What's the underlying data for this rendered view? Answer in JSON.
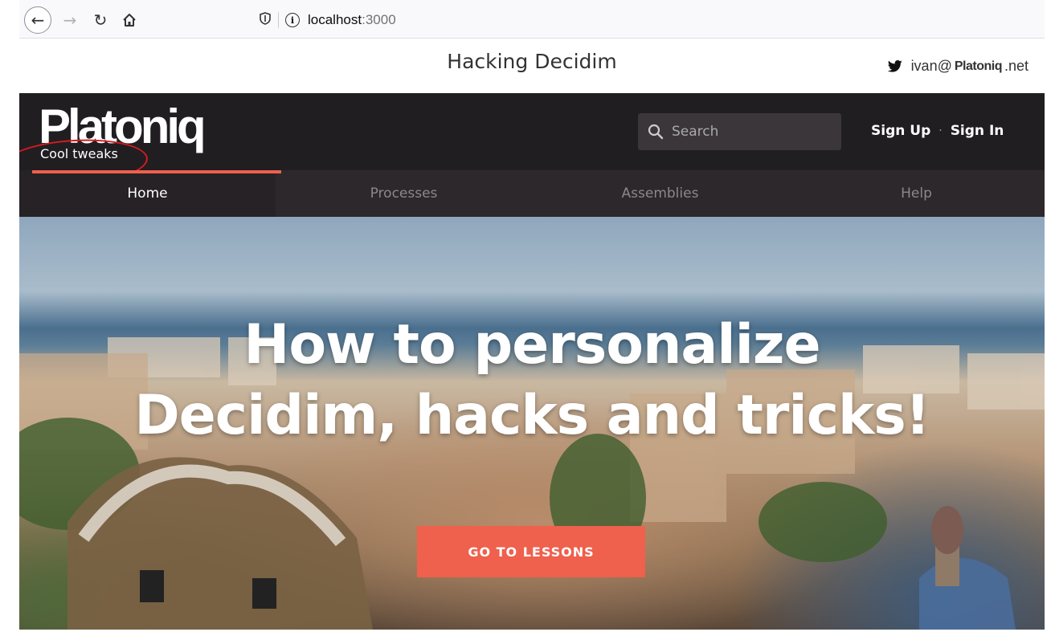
{
  "browser": {
    "url_host": "localhost",
    "url_port": ":3000",
    "back_icon": "back-arrow-icon",
    "forward_icon": "forward-arrow-icon",
    "reload_icon": "reload-icon",
    "home_icon": "home-icon",
    "shield_icon": "shield-icon",
    "info_icon": "info-icon"
  },
  "banner": {
    "title": "Hacking Decidim",
    "contact_prefix": "ivan@",
    "contact_brand": "Platoniq",
    "contact_suffix": ".net",
    "contact_icon": "twitter-icon"
  },
  "header": {
    "logo": "Platoniq",
    "tagline": "Cool tweaks",
    "search_placeholder": "Search",
    "sign_up": "Sign Up",
    "separator": "·",
    "sign_in": "Sign In"
  },
  "nav": {
    "items": [
      {
        "label": "Home",
        "active": true
      },
      {
        "label": "Processes",
        "active": false
      },
      {
        "label": "Assemblies",
        "active": false
      },
      {
        "label": "Help",
        "active": false
      }
    ]
  },
  "hero": {
    "title_line1": "How to personalize",
    "title_line2": "Decidim, hacks and tricks!",
    "cta_label": "GO TO LESSONS"
  },
  "colors": {
    "header_bg": "#211e22",
    "nav_bg": "#2c282c",
    "accent": "#ef604d",
    "annotation": "#d41c1c"
  }
}
